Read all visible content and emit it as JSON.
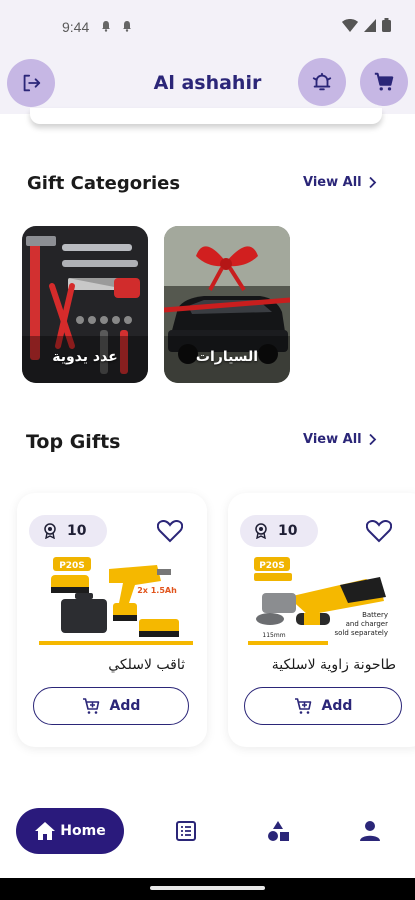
{
  "status_bar": {
    "time": "9:44"
  },
  "header": {
    "title": "Al ashahir"
  },
  "gift_categories": {
    "title": "Gift Categories",
    "view_all": "View All",
    "items": [
      {
        "label": "عدد يدوية"
      },
      {
        "label": "السيارات"
      }
    ]
  },
  "top_gifts": {
    "title": "Top Gifts",
    "view_all": "View All",
    "items": [
      {
        "points": "10",
        "name": "ثاقب لاسلكي",
        "add_label": "Add",
        "badge": "P20S",
        "tag": "2x 1.5Ah"
      },
      {
        "points": "10",
        "name": "طاحونة زاوية لاسلكية",
        "add_label": "Add",
        "badge": "P20S",
        "note_line1": "Battery",
        "note_line2": "and charger",
        "note_line3": "sold separately",
        "size": "115mm"
      }
    ]
  },
  "bottom_nav": {
    "home_label": "Home"
  },
  "colors": {
    "brand": "#2b2678",
    "pill": "#2a1a7c",
    "header_button": "#c6b7e4"
  },
  "icons": [
    "logout-icon",
    "bell-icon",
    "cart-icon",
    "heart-icon",
    "medal-icon",
    "cart-plus-icon",
    "home-icon",
    "list-icon",
    "shapes-icon",
    "profile-icon"
  ]
}
